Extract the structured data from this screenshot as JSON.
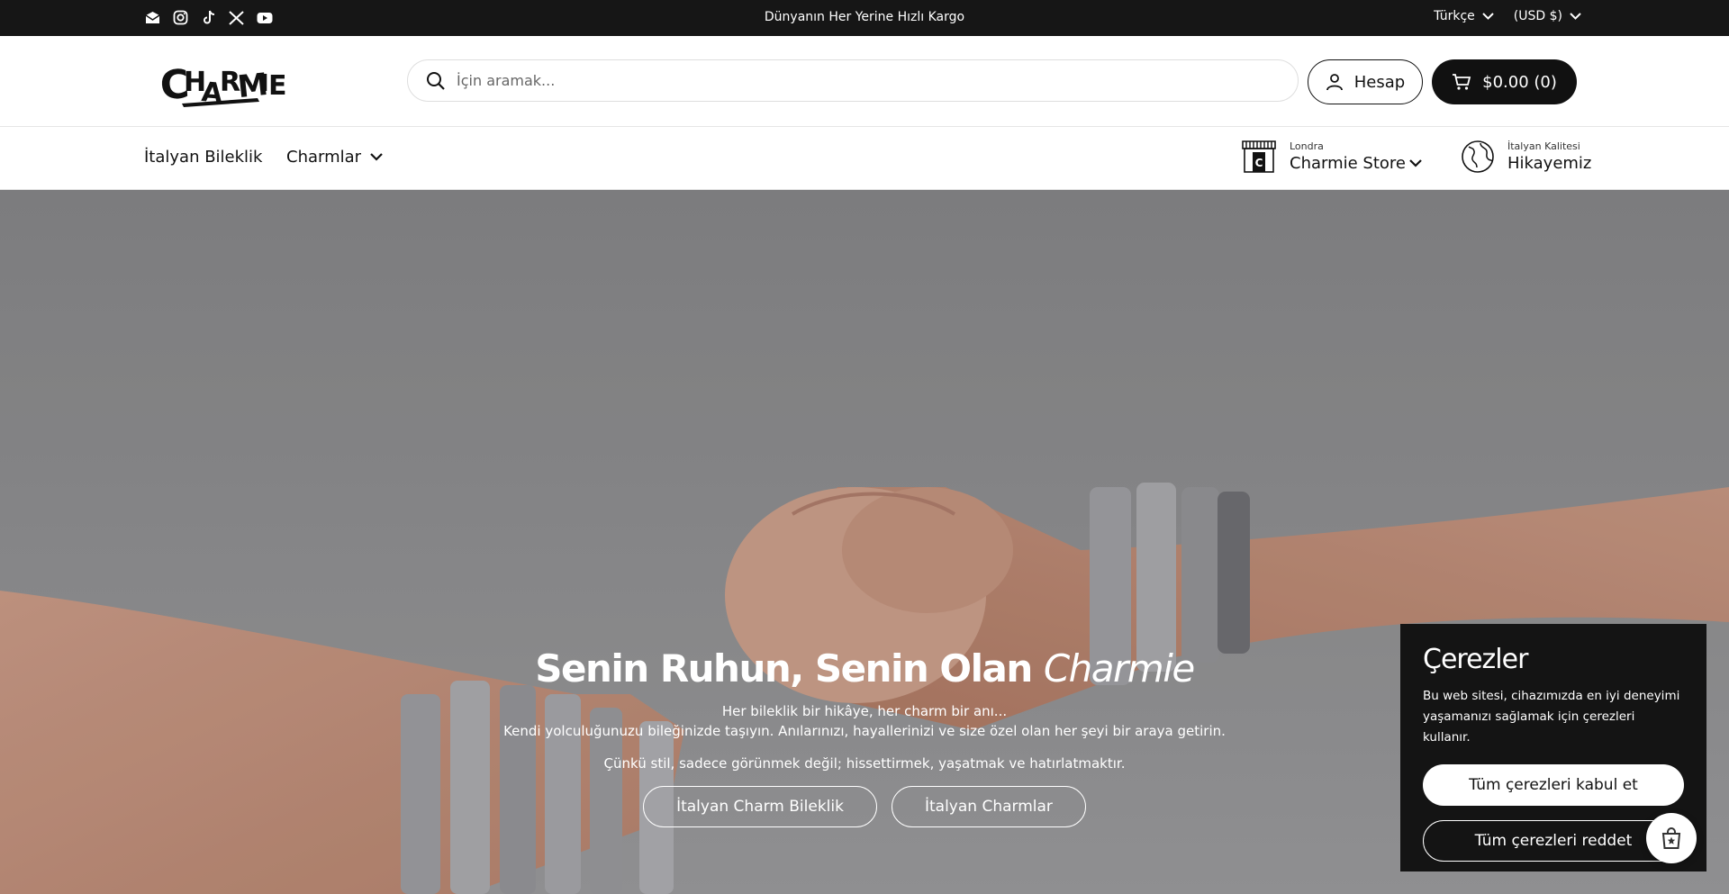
{
  "topbar": {
    "announcement": "Dünyanın Her Yerine Hızlı Kargo",
    "language": "Türkçe",
    "currency": "(USD $)",
    "social_icons": [
      "email-icon",
      "instagram-icon",
      "tiktok-icon",
      "x-icon",
      "youtube-icon"
    ]
  },
  "header": {
    "logo_text": "CHARMIE",
    "search_placeholder": "İçin aramak...",
    "account_label": "Hesap",
    "cart_label": "$0.00 (0)"
  },
  "nav": {
    "items": [
      {
        "label": "İtalyan Bileklik"
      },
      {
        "label": "Charmlar"
      }
    ],
    "store": {
      "small": "Londra",
      "label": "Charmie Store"
    },
    "story": {
      "small": "İtalyan Kalitesi",
      "label": "Hikayemiz"
    }
  },
  "hero": {
    "title_main": "Senin Ruhun, Senin Olan ",
    "title_em": "Charmie",
    "line1": "Her bileklik bir hikâye, her charm bir anı...",
    "line2": "Kendi yolculuğunuzu bileğinizde taşıyın. Anılarınızı, hayallerinizi ve size özel olan her şeyi bir araya getirin.",
    "line3": "Çünkü stil, sadece görünmek değil; hissettirmek, yaşatmak ve hatırlatmaktır.",
    "button1": "İtalyan Charm Bileklik",
    "button2": "İtalyan Charmlar"
  },
  "cookie": {
    "title": "Çerezler",
    "text": "Bu web sitesi, cihazımızda en iyi deneyimi yaşamanızı sağlamak için çerezleri kullanır.",
    "accept": "Tüm çerezleri kabul et",
    "reject": "Tüm çerezleri reddet"
  },
  "colors": {
    "dark": "#161616",
    "white": "#ffffff",
    "skin": "#e8b9a3"
  }
}
